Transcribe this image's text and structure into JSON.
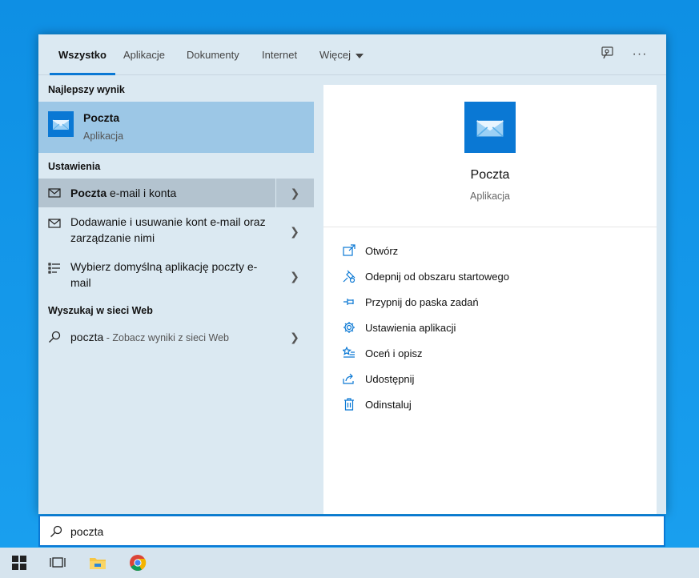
{
  "tabs": [
    {
      "label": "Wszystko",
      "active": true
    },
    {
      "label": "Aplikacje"
    },
    {
      "label": "Dokumenty"
    },
    {
      "label": "Internet"
    },
    {
      "label": "Więcej"
    }
  ],
  "header_icons": [
    "feedback-icon",
    "more-options-icon"
  ],
  "left": {
    "best_match_title": "Najlepszy wynik",
    "best_match": {
      "name": "Poczta",
      "type": "Aplikacja",
      "icon": "mail-app-icon"
    },
    "settings_title": "Ustawienia",
    "settings": [
      {
        "bold": "Poczta",
        "rest": " e-mail i konta",
        "icon": "envelope-icon"
      },
      {
        "text": "Dodawanie i usuwanie kont e-mail oraz zarządzanie nimi",
        "icon": "envelope-icon"
      },
      {
        "text": "Wybierz domyślną aplikację poczty e-mail",
        "icon": "list-settings-icon"
      }
    ],
    "web_title": "Wyszukaj w sieci Web",
    "web": {
      "query": "poczta",
      "suffix": " - Zobacz wyniki z sieci Web",
      "icon": "search-icon"
    }
  },
  "right": {
    "app_name": "Poczta",
    "app_type": "Aplikacja",
    "actions": [
      {
        "label": "Otwórz",
        "icon": "open-icon"
      },
      {
        "label": "Odepnij od obszaru startowego",
        "icon": "unpin-icon"
      },
      {
        "label": "Przypnij do paska zadań",
        "icon": "pin-icon"
      },
      {
        "label": "Ustawienia aplikacji",
        "icon": "gear-icon"
      },
      {
        "label": "Oceń i opisz",
        "icon": "rate-icon"
      },
      {
        "label": "Udostępnij",
        "icon": "share-icon"
      },
      {
        "label": "Odinstaluj",
        "icon": "trash-icon"
      }
    ]
  },
  "search": {
    "value": "poczta"
  },
  "taskbar": [
    "windows-start-icon",
    "task-view-icon",
    "file-explorer-icon",
    "chrome-icon"
  ],
  "colors": {
    "accent": "#0a78d4",
    "panel": "#dbe9f2",
    "selected": "#9cc7e6"
  }
}
